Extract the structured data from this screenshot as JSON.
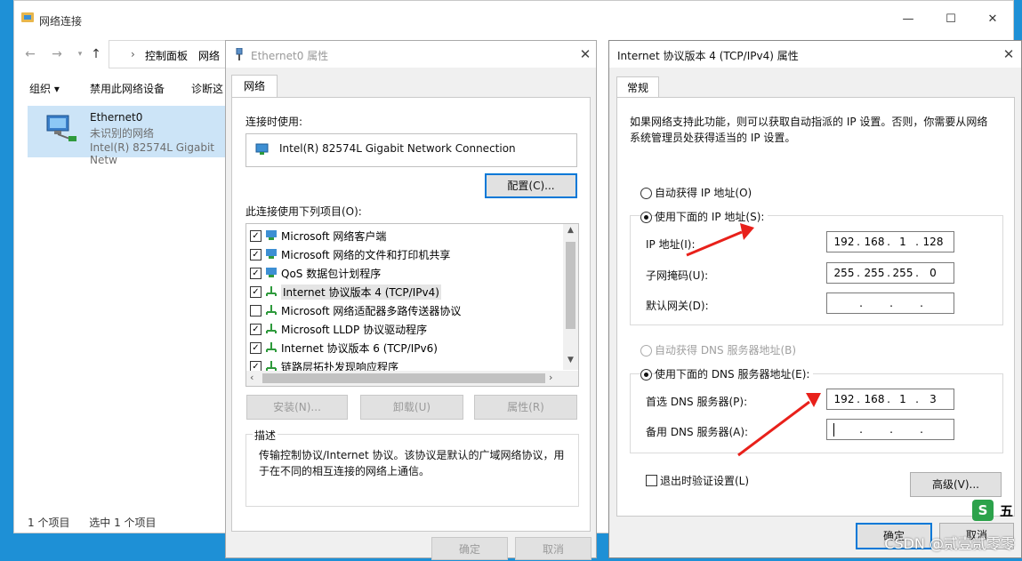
{
  "explorer": {
    "title": "网络连接",
    "controls": [
      "—",
      "☐",
      "✕"
    ],
    "breadcrumb": [
      "控制面板",
      "网络"
    ],
    "commands": [
      "组织 ▾",
      "禁用此网络设备",
      "诊断这"
    ],
    "item": {
      "name": "Ethernet0",
      "status": "未识别的网络",
      "adapter": "Intel(R) 82574L Gigabit Netw"
    },
    "status_count": "1 个项目",
    "status_selected": "选中 1 个项目"
  },
  "eth_dialog": {
    "title": "Ethernet0 属性",
    "tab": "网络",
    "connect_using_label": "连接时使用:",
    "adapter": "Intel(R) 82574L Gigabit Network Connection",
    "configure_button": "配置(C)...",
    "items_label": "此连接使用下列项目(O):",
    "items": [
      {
        "label": "Microsoft 网络客户端",
        "checked": true
      },
      {
        "label": "Microsoft 网络的文件和打印机共享",
        "checked": true
      },
      {
        "label": "QoS 数据包计划程序",
        "checked": true
      },
      {
        "label": "Internet 协议版本 4 (TCP/IPv4)",
        "checked": true
      },
      {
        "label": "Microsoft 网络适配器多路传送器协议",
        "checked": false
      },
      {
        "label": "Microsoft LLDP 协议驱动程序",
        "checked": true
      },
      {
        "label": "Internet 协议版本 6 (TCP/IPv6)",
        "checked": true
      },
      {
        "label": "链路层拓扑发现响应程序",
        "checked": true
      }
    ],
    "install_button": "安装(N)...",
    "uninstall_button": "卸载(U)",
    "properties_button": "属性(R)",
    "description_label": "描述",
    "description_text": "传输控制协议/Internet 协议。该协议是默认的广域网络协议，用于在不同的相互连接的网络上通信。",
    "ok_button": "确定",
    "cancel_button": "取消"
  },
  "ipv4_dialog": {
    "title": "Internet 协议版本 4 (TCP/IPv4) 属性",
    "tab": "常规",
    "intro": "如果网络支持此功能，则可以获取自动指派的 IP 设置。否则，你需要从网络系统管理员处获得适当的 IP 设置。",
    "auto_ip": "自动获得 IP 地址(O)",
    "manual_ip": "使用下面的 IP 地址(S):",
    "ip_label": "IP 地址(I):",
    "ip": [
      "192",
      "168",
      "1",
      "128"
    ],
    "mask_label": "子网掩码(U):",
    "mask": [
      "255",
      "255",
      "255",
      "0"
    ],
    "gateway_label": "默认网关(D):",
    "gateway": [
      "",
      "",
      "",
      ""
    ],
    "auto_dns": "自动获得 DNS 服务器地址(B)",
    "manual_dns": "使用下面的 DNS 服务器地址(E):",
    "dns1_label": "首选 DNS 服务器(P):",
    "dns1": [
      "192",
      "168",
      "1",
      "3"
    ],
    "dns2_label": "备用 DNS 服务器(A):",
    "dns2": [
      "",
      "",
      "",
      ""
    ],
    "validate_label": "退出时验证设置(L)",
    "advanced_button": "高级(V)...",
    "ok_button": "确定",
    "cancel_button": "取消"
  },
  "watermark": "CSDN @贰壹贰零零",
  "colors": {
    "desktop": "#1e90d6",
    "selection": "#cce4f7",
    "focus": "#0078d7",
    "annotation": "#e8201a"
  }
}
